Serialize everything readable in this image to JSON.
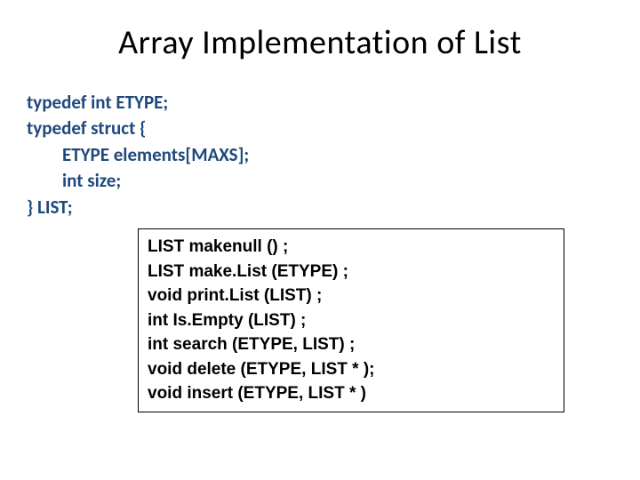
{
  "title": "Array Implementation of List",
  "code": {
    "l1": "typedef int ETYPE;",
    "l2": "typedef struct {",
    "l3": "ETYPE elements[MAXS];",
    "l4": "int size;",
    "l5": "} LIST;"
  },
  "funcs": {
    "f1": "LIST makenull () ;",
    "f2": "LIST make.List (ETYPE) ;",
    "f3": "void print.List (LIST) ;",
    "f4": "int Is.Empty (LIST) ;",
    "f5": "int search (ETYPE, LIST) ;",
    "f6": "void delete (ETYPE, LIST * );",
    "f7": "void insert (ETYPE, LIST * )"
  }
}
